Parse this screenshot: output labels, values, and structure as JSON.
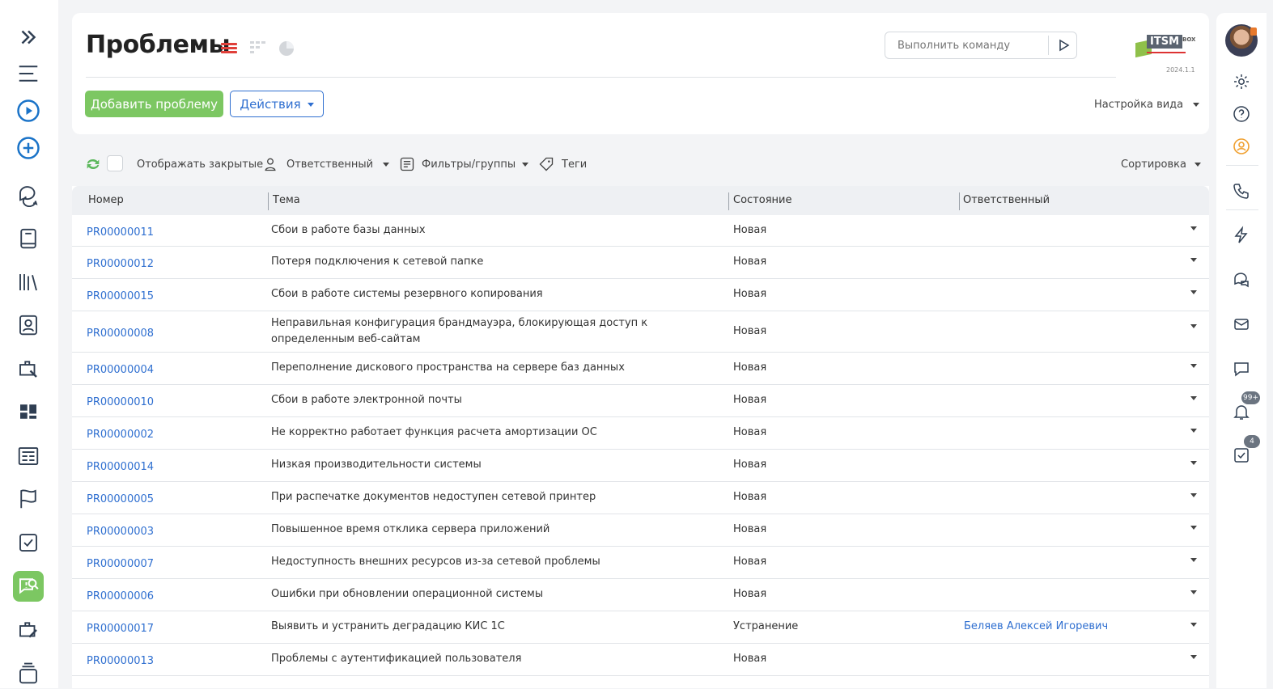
{
  "left_nav": {
    "items": [
      {
        "icon": "expand-icon",
        "name": "expand-sidebar"
      },
      {
        "icon": "menu-icon",
        "name": "menu"
      },
      {
        "icon": "play-circle-icon",
        "name": "run"
      },
      {
        "icon": "plus-circle-icon",
        "name": "create"
      },
      {
        "icon": "chat-bubbles-icon",
        "name": "communications"
      },
      {
        "icon": "book-icon",
        "name": "knowledge-base"
      },
      {
        "icon": "library-icon",
        "name": "catalog"
      },
      {
        "icon": "contact-card-icon",
        "name": "contacts"
      },
      {
        "icon": "briefcase-wrench-icon",
        "name": "services"
      },
      {
        "icon": "dashboard-icon",
        "name": "dashboards"
      },
      {
        "icon": "newspaper-icon",
        "name": "news"
      },
      {
        "icon": "flag-icon",
        "name": "milestones"
      },
      {
        "icon": "checkbox-icon",
        "name": "tasks"
      },
      {
        "icon": "problem-search-icon",
        "name": "problems",
        "active": true
      },
      {
        "icon": "briefcase-edit-icon",
        "name": "changes"
      },
      {
        "icon": "calendar-stack-icon",
        "name": "calendar"
      }
    ]
  },
  "right_nav": {
    "badges": {
      "notifications": "99+",
      "tasks": "4"
    }
  },
  "header": {
    "title": "Проблемы",
    "command_placeholder": "Выполнить команду",
    "logo_text": "ITSM",
    "logo_suffix": "BOX",
    "version": "2024.1.1",
    "add_button": "Добавить проблему",
    "actions_button": "Действия",
    "view_settings": "Настройка вида"
  },
  "filters": {
    "show_closed": "Отображать закрытые",
    "responsible": "Ответственный",
    "filters_groups": "Фильтры/группы",
    "tags": "Теги",
    "sort": "Сортировка"
  },
  "table": {
    "columns": [
      "Номер",
      "Тема",
      "Состояние",
      "Ответственный"
    ],
    "rows": [
      {
        "id": "PR00000011",
        "topic": "Сбои в работе базы данных",
        "state": "Новая",
        "responsible": ""
      },
      {
        "id": "PR00000012",
        "topic": "Потеря подключения к сетевой папке",
        "state": "Новая",
        "responsible": ""
      },
      {
        "id": "PR00000015",
        "topic": "Сбои в работе системы резервного копирования",
        "state": "Новая",
        "responsible": ""
      },
      {
        "id": "PR00000008",
        "topic": "Неправильная конфигурация брандмауэра, блокирующая доступ к определенным веб-сайтам",
        "state": "Новая",
        "responsible": ""
      },
      {
        "id": "PR00000004",
        "topic": "Переполнение дискового пространства на сервере баз данных",
        "state": "Новая",
        "responsible": ""
      },
      {
        "id": "PR00000010",
        "topic": "Сбои в работе электронной почты",
        "state": "Новая",
        "responsible": ""
      },
      {
        "id": "PR00000002",
        "topic": "Не корректно работает функция расчета амортизации ОС",
        "state": "Новая",
        "responsible": ""
      },
      {
        "id": "PR00000014",
        "topic": "Низкая производительности системы",
        "state": "Новая",
        "responsible": ""
      },
      {
        "id": "PR00000005",
        "topic": "При распечатке документов недоступен сетевой принтер",
        "state": "Новая",
        "responsible": ""
      },
      {
        "id": "PR00000003",
        "topic": "Повышенное время отклика сервера приложений",
        "state": "Новая",
        "responsible": ""
      },
      {
        "id": "PR00000007",
        "topic": "Недоступность внешних ресурсов из-за сетевой проблемы",
        "state": "Новая",
        "responsible": ""
      },
      {
        "id": "PR00000006",
        "topic": "Ошибки при обновлении операционной системы",
        "state": "Новая",
        "responsible": ""
      },
      {
        "id": "PR00000017",
        "topic": "Выявить и устранить деградацию КИС 1С",
        "state": "Устранение",
        "responsible": "Беляев Алексей Игоревич"
      },
      {
        "id": "PR00000013",
        "topic": "Проблемы с аутентификацией пользователя",
        "state": "Новая",
        "responsible": ""
      }
    ]
  },
  "colors": {
    "accent_green": "#7cc762",
    "link_blue": "#2f6fd0",
    "view_active_red": "#e0403a",
    "alert_orange": "#f0a030"
  }
}
